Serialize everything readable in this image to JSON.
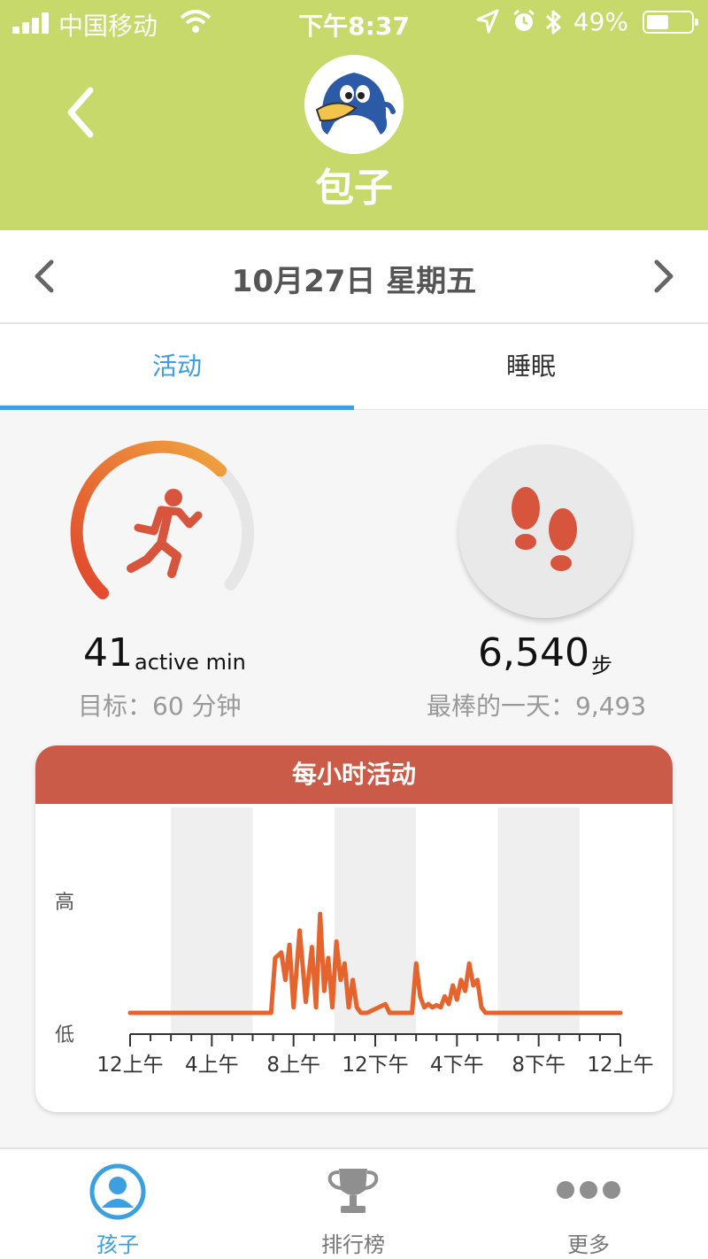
{
  "status_bar": {
    "carrier": "中国移动",
    "time": "下午8:37",
    "battery": "49%",
    "battery_level": 0.49
  },
  "header": {
    "back_icon": "chevron-left-icon",
    "avatar_icon": "penguin-avatar",
    "name": "包子"
  },
  "date_nav": {
    "label": "10月27日 星期五",
    "prev_icon": "chevron-left-icon",
    "next_icon": "chevron-right-icon"
  },
  "tabs": [
    {
      "label": "活动",
      "active": true
    },
    {
      "label": "睡眠",
      "active": false
    }
  ],
  "activity": {
    "value": "41",
    "unit": "active min",
    "goal_text": "目标：60 分钟",
    "progress": 0.6833,
    "icon": "running-person-icon"
  },
  "steps": {
    "value": "6,540",
    "unit": "步",
    "best_text": "最棒的一天：9,493",
    "icon": "footprints-icon"
  },
  "hourly_chart": {
    "title": "每小时活动"
  },
  "chart_data": {
    "type": "line",
    "title": "每小时活动",
    "y_labels": [
      "高",
      "低"
    ],
    "x_tick_labels": [
      "12上午",
      "4上午",
      "8上午",
      "12下午",
      "4下午",
      "8下午",
      "12上午"
    ],
    "xlim": [
      0,
      24
    ],
    "ylim": [
      0,
      1
    ],
    "color": "#e5642e",
    "x": [
      0,
      6.9,
      7.1,
      7.4,
      7.6,
      7.8,
      8.0,
      8.3,
      8.6,
      8.9,
      9.1,
      9.3,
      9.5,
      9.7,
      9.9,
      10.1,
      10.3,
      10.5,
      10.7,
      10.9,
      11.1,
      11.3,
      11.6,
      12.5,
      12.7,
      12.9,
      13.8,
      14.0,
      14.2,
      14.4,
      14.6,
      14.8,
      15.0,
      15.2,
      15.4,
      15.6,
      15.8,
      16.0,
      16.2,
      16.4,
      16.6,
      16.8,
      17.0,
      17.2,
      17.4,
      17.6,
      17.8,
      18.0,
      24
    ],
    "y": [
      0,
      0,
      0.5,
      0.55,
      0.3,
      0.62,
      0.05,
      0.75,
      0.1,
      0.6,
      0.05,
      0.9,
      0.2,
      0.5,
      0.05,
      0.65,
      0.3,
      0.45,
      0.05,
      0.3,
      0.05,
      0,
      0,
      0.08,
      0,
      0,
      0,
      0.45,
      0.15,
      0.05,
      0.08,
      0.05,
      0.07,
      0.05,
      0.15,
      0.08,
      0.25,
      0.12,
      0.3,
      0.2,
      0.45,
      0.25,
      0.3,
      0.05,
      0,
      0,
      0,
      0,
      0
    ]
  },
  "tab_bar": [
    {
      "label": "孩子",
      "icon": "child-profile-icon",
      "active": true
    },
    {
      "label": "排行榜",
      "icon": "trophy-icon",
      "active": false
    },
    {
      "label": "更多",
      "icon": "more-dots-icon",
      "active": false
    }
  ],
  "colors": {
    "header": "#c6d96a",
    "accent_blue": "#3b9fe0",
    "activity_orange": "#e5642e",
    "card_header": "#c95b48"
  }
}
